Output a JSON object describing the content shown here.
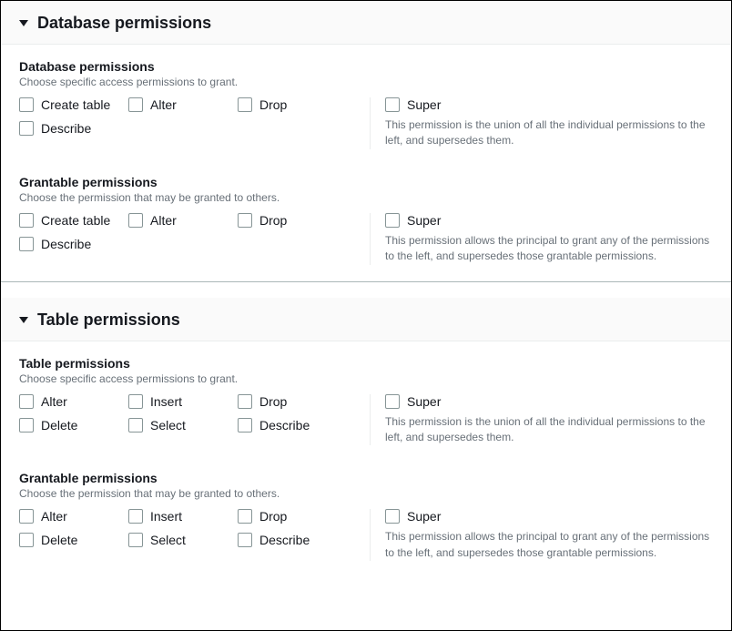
{
  "panels": {
    "database": {
      "title": "Database permissions",
      "sections": {
        "perm": {
          "title": "Database permissions",
          "subtitle": "Choose specific access permissions to grant.",
          "options": {
            "o0": "Create table",
            "o1": "Alter",
            "o2": "Drop",
            "o3": "Describe"
          },
          "super_label": "Super",
          "super_desc": "This permission is the union of all the individual permissions to the left, and supersedes them."
        },
        "grant": {
          "title": "Grantable permissions",
          "subtitle": "Choose the permission that may be granted to others.",
          "options": {
            "o0": "Create table",
            "o1": "Alter",
            "o2": "Drop",
            "o3": "Describe"
          },
          "super_label": "Super",
          "super_desc": "This permission allows the principal to grant any of the permissions to the left, and supersedes those grantable permissions."
        }
      }
    },
    "table": {
      "title": "Table permissions",
      "sections": {
        "perm": {
          "title": "Table permissions",
          "subtitle": "Choose specific access permissions to grant.",
          "options": {
            "o0": "Alter",
            "o1": "Insert",
            "o2": "Drop",
            "o3": "Delete",
            "o4": "Select",
            "o5": "Describe"
          },
          "super_label": "Super",
          "super_desc": "This permission is the union of all the individual permissions to the left, and supersedes them."
        },
        "grant": {
          "title": "Grantable permissions",
          "subtitle": "Choose the permission that may be granted to others.",
          "options": {
            "o0": "Alter",
            "o1": "Insert",
            "o2": "Drop",
            "o3": "Delete",
            "o4": "Select",
            "o5": "Describe"
          },
          "super_label": "Super",
          "super_desc": "This permission allows the principal to grant any of the permissions to the left, and supersedes those grantable permissions."
        }
      }
    }
  }
}
